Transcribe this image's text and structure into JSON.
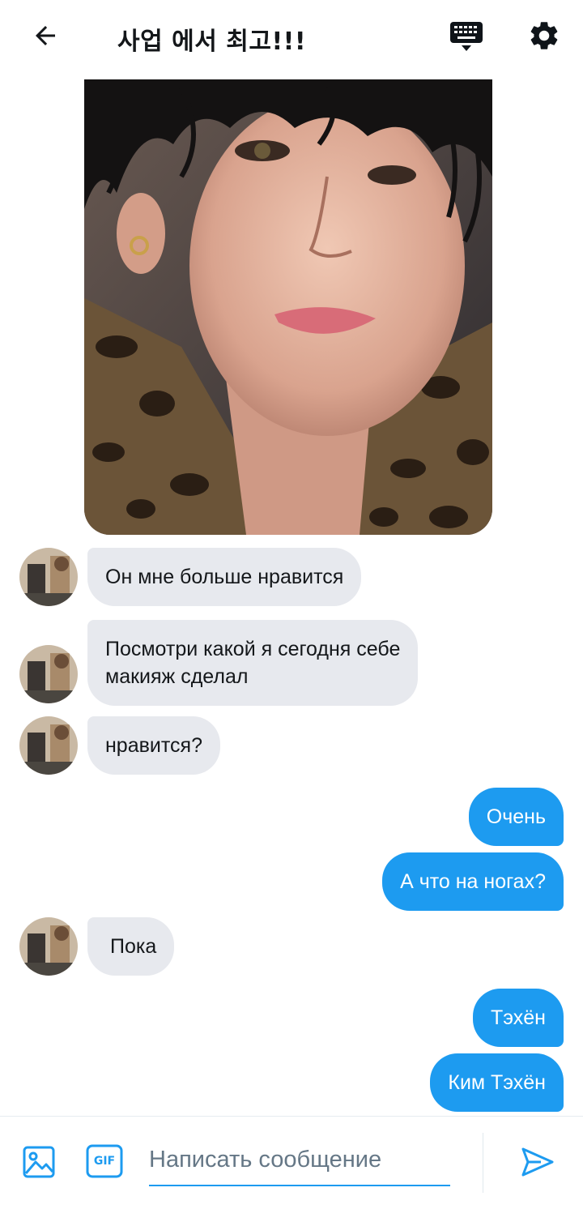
{
  "header": {
    "title": "사업 에서 최고!!!",
    "icons": [
      "back-arrow-icon",
      "keyboard-icon",
      "gear-icon"
    ]
  },
  "messages": [
    {
      "side": "incoming",
      "text": "Он мне больше нравится"
    },
    {
      "side": "incoming",
      "text_line1": "Посмотри какой я сегодня себе",
      "text_line2": "макияж сделал"
    },
    {
      "side": "incoming",
      "text": "нравится?"
    },
    {
      "side": "outgoing",
      "text": "Очень"
    },
    {
      "side": "outgoing",
      "text": "А что на ногах?"
    },
    {
      "side": "incoming",
      "text": "Пока"
    },
    {
      "side": "outgoing",
      "text": "Тэхён"
    },
    {
      "side": "outgoing",
      "text": "Ким Тэхён"
    }
  ],
  "composer": {
    "placeholder": "Написать сообщение",
    "gif_label": "GIF",
    "icons": [
      "image-icon",
      "gif-icon",
      "send-icon"
    ]
  },
  "colors": {
    "accent": "#1d9bf0",
    "incoming_bubble": "#e7e9ee",
    "outgoing_text": "#ffffff"
  }
}
